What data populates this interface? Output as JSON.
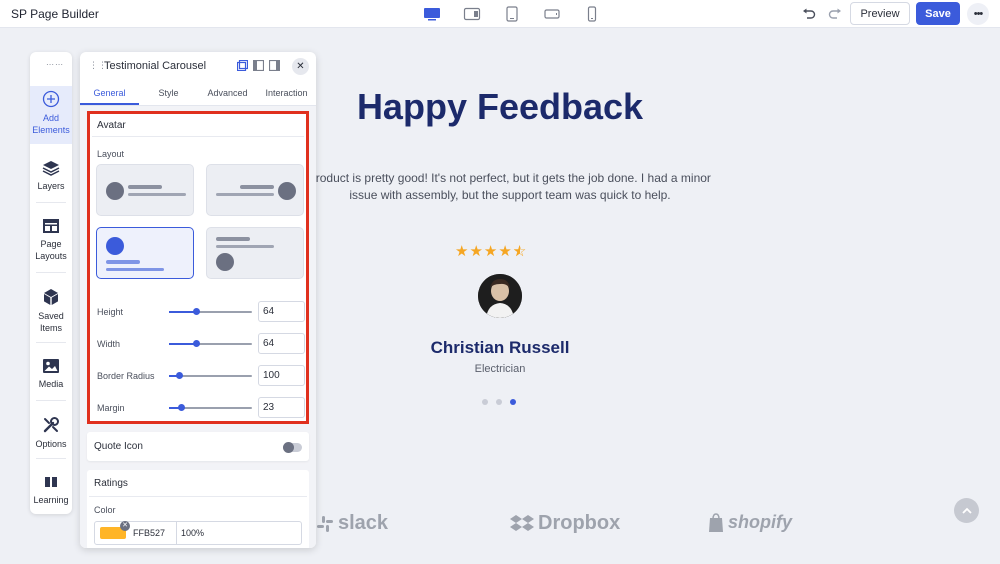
{
  "app": {
    "title": "SP Page Builder"
  },
  "toolbar": {
    "devices": [
      "desktop-icon",
      "tablet-landscape-icon",
      "tablet-portrait-icon",
      "mobile-landscape-icon",
      "mobile-portrait-icon"
    ],
    "preview_label": "Preview",
    "save_label": "Save",
    "more_label": "•••"
  },
  "canvas": {
    "headline": "Happy Feedback",
    "quote": "product is pretty good! It's not perfect, but it gets the job done. I had a minor issue with assembly, but the support team was quick to help.",
    "rating": 4.5,
    "person_name": "Christian Russell",
    "person_role": "Electrician",
    "carousel_active_index": 2,
    "logos": [
      "slack",
      "Dropbox",
      "shopify"
    ]
  },
  "sidebar": {
    "items": [
      {
        "label": "Add Elements",
        "icon": "plus-circle-icon"
      },
      {
        "label": "Layers",
        "icon": "layers-icon"
      },
      {
        "label": "Page Layouts",
        "icon": "page-layouts-icon"
      },
      {
        "label": "Saved Items",
        "icon": "cube-icon"
      },
      {
        "label": "Media",
        "icon": "image-icon"
      },
      {
        "label": "Options",
        "icon": "wrench-icon"
      },
      {
        "label": "Learning",
        "icon": "book-icon"
      }
    ]
  },
  "panel": {
    "title": "Testimonial Carousel",
    "tabs": [
      "General",
      "Style",
      "Advanced",
      "Interaction"
    ],
    "active_tab": "General",
    "avatar_section": {
      "title": "Avatar",
      "layout_label": "Layout",
      "selected_layout": 3,
      "height_label": "Height",
      "height_value": "64",
      "width_label": "Width",
      "width_value": "64",
      "radius_label": "Border Radius",
      "radius_value": "100",
      "margin_label": "Margin",
      "margin_value": "23"
    },
    "quote_icon": {
      "label": "Quote Icon",
      "enabled": false
    },
    "ratings": {
      "title": "Ratings",
      "color_label": "Color",
      "color_hex": "FFB527",
      "color_value": "#ffb527",
      "opacity": "100%"
    }
  },
  "colors": {
    "accent": "#3b5bdb",
    "heading": "#1c2a6b",
    "star": "#f5a623",
    "highlight": "#e0301e"
  }
}
